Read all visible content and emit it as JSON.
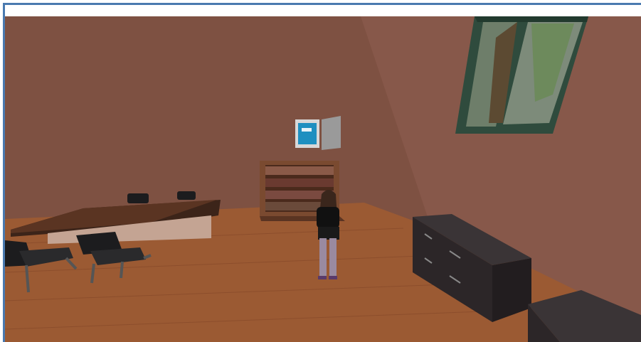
{
  "window": {
    "title": ""
  },
  "scene": {
    "type": "3d-virtual-world",
    "colors": {
      "wall_back": "#7e5142",
      "wall_right": "#8a5b49",
      "floor": "#9a5a34",
      "floor_dark": "#7a4426",
      "table_top": "#5a3422",
      "chair": "#1c1c1e",
      "cabinet": "#2c2628",
      "window_frame": "#2f4a3c",
      "screen": "#1e8fc0",
      "bookcase": "#7a4a30",
      "avatar_hair": "#3a261c",
      "avatar_top": "#111111"
    },
    "objects": [
      "back-wall",
      "right-wall",
      "wooden-floor",
      "conference-table",
      "office-chairs",
      "bookcase",
      "wall-monitor",
      "window",
      "filing-cabinets",
      "avatar"
    ]
  }
}
